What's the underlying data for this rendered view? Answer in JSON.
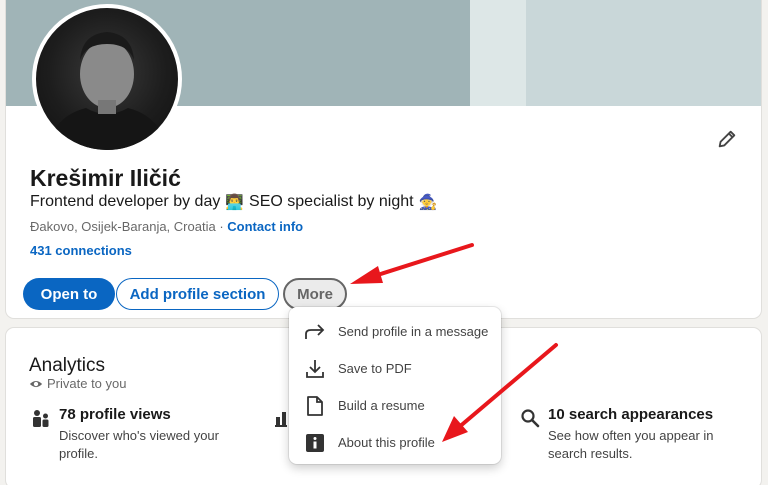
{
  "profile": {
    "name": "Krešimir Iličić",
    "headline_part1": "Frontend developer by day",
    "headline_emoji1": "👨‍💻",
    "headline_part2": "SEO specialist by night",
    "headline_emoji2": "🧙",
    "location": "Đakovo, Osijek-Baranja, Croatia",
    "location_separator": " · ",
    "contact_info": "Contact info",
    "connections": "431 connections",
    "edit_icon": "pencil-icon"
  },
  "actions": {
    "open_to": "Open to",
    "add_section": "Add profile section",
    "more": "More"
  },
  "menu": {
    "items": [
      {
        "label": "Send profile in a message",
        "icon": "share-arrow-icon"
      },
      {
        "label": "Save to PDF",
        "icon": "download-icon"
      },
      {
        "label": "Build a resume",
        "icon": "document-icon"
      },
      {
        "label": "About this profile",
        "icon": "info-icon"
      }
    ]
  },
  "analytics": {
    "title": "Analytics",
    "private": "Private to you",
    "stats": [
      {
        "title": "78 profile views",
        "desc": "Discover who's viewed your profile.",
        "icon": "people-icon"
      },
      {
        "title": "",
        "desc": "",
        "icon": "bar-chart-icon"
      },
      {
        "title": "10 search appearances",
        "desc": "See how often you appear in search results.",
        "icon": "search-icon"
      }
    ]
  },
  "colors": {
    "brand_blue": "#0a66c2",
    "annotation_red": "#e8171c",
    "cover_gray": "#a0b4b7"
  }
}
